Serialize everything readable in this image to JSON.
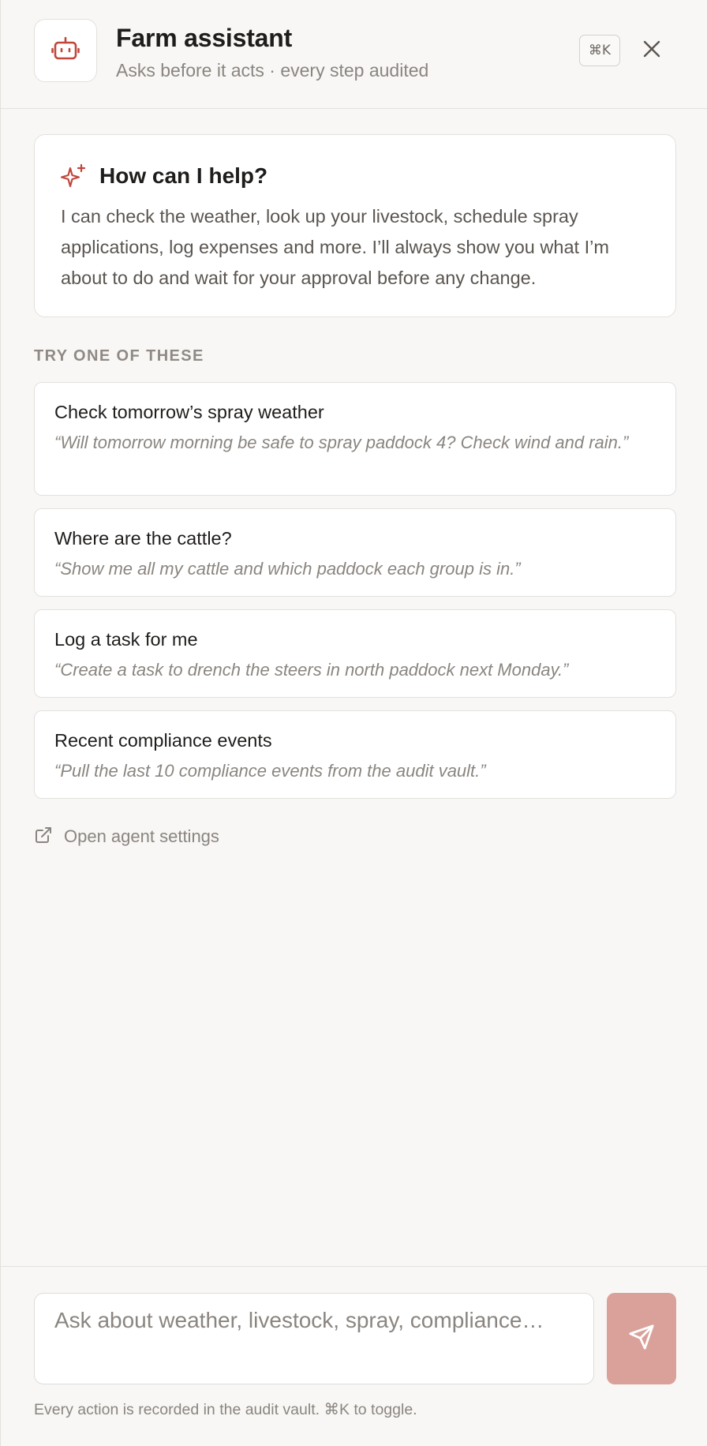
{
  "header": {
    "title": "Farm assistant",
    "subtitle": "Asks before it acts · every step audited",
    "shortcut": "⌘K",
    "logo_icon": "robot-icon",
    "close_icon": "close-icon"
  },
  "intro": {
    "icon": "sparkles-icon",
    "title": "How can I help?",
    "text": "I can check the weather, look up your livestock, schedule spray applications, log expenses and more. I’ll always show you what I’m about to do and wait for your approval before any change."
  },
  "suggestions_label": "TRY ONE OF THESE",
  "suggestions": [
    {
      "title": "Check tomorrow’s spray weather",
      "prompt": "“Will tomorrow morning be safe to spray paddock 4? Check wind and rain.”"
    },
    {
      "title": "Where are the cattle?",
      "prompt": "“Show me all my cattle and which paddock each group is in.”"
    },
    {
      "title": "Log a task for me",
      "prompt": "“Create a task to drench the steers in north paddock next Monday.”"
    },
    {
      "title": "Recent compliance events",
      "prompt": "“Pull the last 10 compliance events from the audit vault.”"
    }
  ],
  "settings_link": {
    "icon": "external-link-icon",
    "label": "Open agent settings"
  },
  "composer": {
    "placeholder": "Ask about weather, livestock, spray, compliance…",
    "send_icon": "send-icon",
    "footer": "Every action is recorded in the audit vault. ⌘K to toggle."
  },
  "colors": {
    "accent": "#c0463a",
    "send_button": "#d9a199",
    "background": "#f8f7f5",
    "card": "#ffffff",
    "border": "#e4e1dd",
    "muted_text": "#8a8580"
  }
}
